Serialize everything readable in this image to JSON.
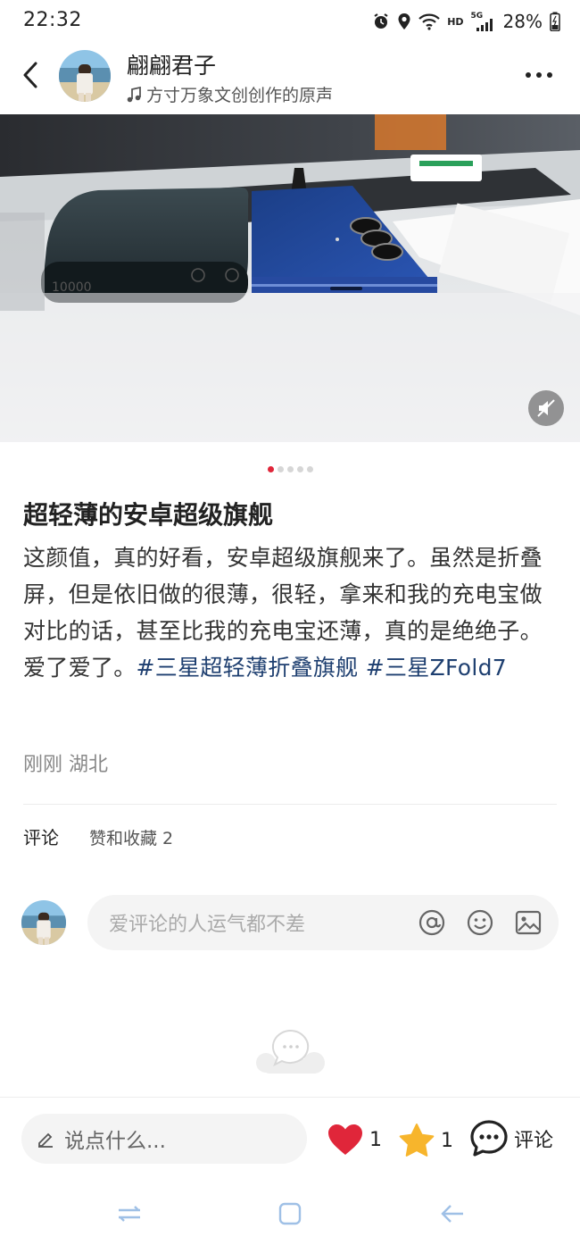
{
  "status_bar": {
    "time": "22:32",
    "network_hd": "HD",
    "network_type": "5G",
    "battery": "28%"
  },
  "header": {
    "author_name": "翩翩君子",
    "music": "方寸万象文创创作的原声"
  },
  "media": {
    "carousel_total": 5,
    "carousel_active_index": 0
  },
  "post": {
    "title": "超轻薄的安卓超级旗舰",
    "body": "这颜值，真的好看，安卓超级旗舰来了。虽然是折叠屏，但是依旧做的很薄，很轻，拿来和我的充电宝做对比的话，甚至比我的充电宝还薄，真的是绝绝子。爱了爱了。",
    "tags": [
      "#三星超轻薄折叠旗舰",
      "#三星ZFold7"
    ],
    "meta": "刚刚 湖北"
  },
  "tabs": {
    "comments": "评论",
    "likes_and_favorites": "赞和收藏 2"
  },
  "comment_box": {
    "placeholder": "爱评论的人运气都不差"
  },
  "bottom_bar": {
    "input_placeholder": "说点什么...",
    "like_count": "1",
    "favorite_count": "1",
    "comment_label": "评论"
  },
  "colors": {
    "accent_red": "#e0263a",
    "tag_blue": "#1e3f70",
    "star_yellow": "#f7b52c"
  },
  "icons": {
    "back": "back-chevron-icon",
    "more": "more-dots-icon",
    "music": "music-note-icon",
    "mute": "speaker-muted-icon",
    "mention": "at-icon",
    "emoji": "emoji-icon",
    "image": "image-icon",
    "edit": "pencil-icon",
    "like": "heart-icon",
    "favorite": "star-icon",
    "comment": "comment-bubble-icon"
  }
}
